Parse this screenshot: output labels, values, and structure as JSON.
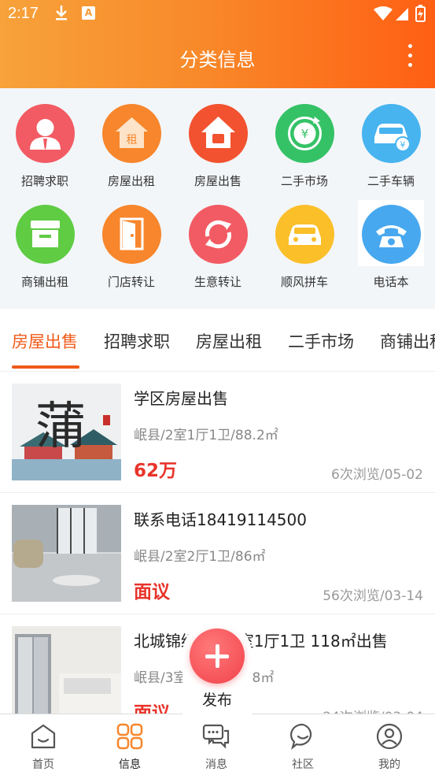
{
  "status_bar": {
    "time": "2:17"
  },
  "header": {
    "title": "分类信息"
  },
  "categories": [
    {
      "label": "招聘求职",
      "icon": "recruit-person-icon",
      "color": "#f25b63"
    },
    {
      "label": "房屋出租",
      "icon": "house-rent-icon",
      "color": "#f7862c"
    },
    {
      "label": "房屋出售",
      "icon": "house-sale-icon",
      "color": "#f2522f"
    },
    {
      "label": "二手市场",
      "icon": "yuan-cycle-icon",
      "color": "#35c267"
    },
    {
      "label": "二手车辆",
      "icon": "car-yuan-icon",
      "color": "#47b4ef"
    },
    {
      "label": "商铺出租",
      "icon": "shop-icon",
      "color": "#5fcc44"
    },
    {
      "label": "门店转让",
      "icon": "door-icon",
      "color": "#f7862c"
    },
    {
      "label": "生意转让",
      "icon": "transfer-cycle-icon",
      "color": "#f25b63"
    },
    {
      "label": "顺风拼车",
      "icon": "carpool-icon",
      "color": "#fbbf2a"
    },
    {
      "label": "电话本",
      "icon": "phone-icon",
      "color": "#47a8ef"
    }
  ],
  "tabs": [
    "房屋出售",
    "招聘求职",
    "房屋出租",
    "二手市场",
    "商铺出租"
  ],
  "listings": [
    {
      "title": "学区房屋出售",
      "detail": "岷县/2室1厅1卫/88.2㎡",
      "price": "62万",
      "meta": "6次浏览/05-02",
      "thumb_text": "蒲"
    },
    {
      "title": "联系电话18419114500",
      "detail": "岷县/2室2厅1卫/86㎡",
      "price": "面议",
      "meta": "56次浏览/03-14"
    },
    {
      "title": "北城锦绣华府3室1厅1卫 118㎡出售",
      "detail": "岷县/3室1厅1卫/118㎡",
      "price": "面议",
      "meta": "24次浏览/03-04"
    }
  ],
  "fab": {
    "label": "发布"
  },
  "bottom_nav": [
    {
      "label": "首页",
      "icon": "home-icon"
    },
    {
      "label": "信息",
      "icon": "grid-info-icon"
    },
    {
      "label": "消息",
      "icon": "message-icon"
    },
    {
      "label": "社区",
      "icon": "community-chat-icon"
    },
    {
      "label": "我的",
      "icon": "profile-icon"
    }
  ],
  "colors": {
    "accent": "#f05a1a",
    "price": "#e8332a",
    "header_start": "#f7a23a",
    "header_end": "#ff5f14"
  }
}
